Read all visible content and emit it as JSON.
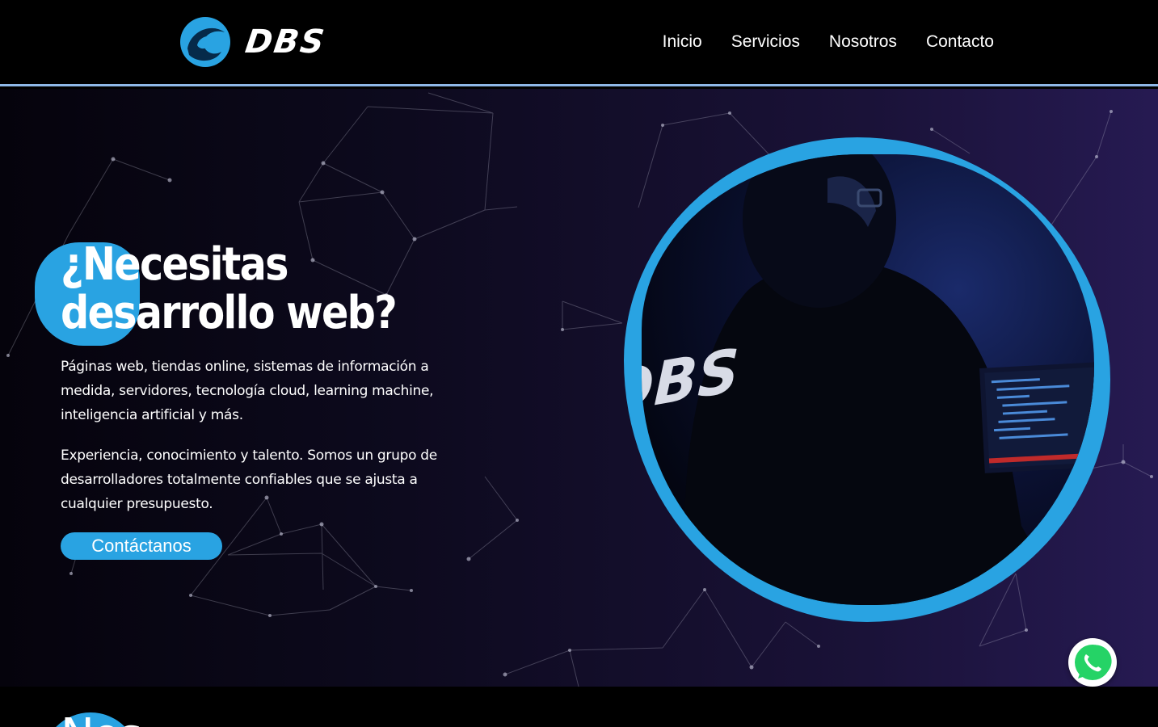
{
  "brand": {
    "name": "DBS",
    "accent": "#29a3e2"
  },
  "nav": {
    "items": [
      "Inicio",
      "Servicios",
      "Nosotros",
      "Contacto"
    ]
  },
  "hero": {
    "title_line1": "¿Necesitas",
    "title_line2": "desarrollo web?",
    "paragraph1": "Páginas web, tiendas online, sistemas de información a medida, servidores, tecnología cloud, learning machine, inteligencia artificial y más.",
    "paragraph2": "Experiencia, conocimiento y talento. Somos un grupo de desarrolladores totalmente confiables que se ajusta a cualquier presupuesto.",
    "cta_label": "Contáctanos",
    "shirt_text": "DBS"
  },
  "next_section": {
    "title_fragment": "Nos"
  },
  "floating": {
    "icon": "whatsapp-icon",
    "color": "#25d366"
  }
}
